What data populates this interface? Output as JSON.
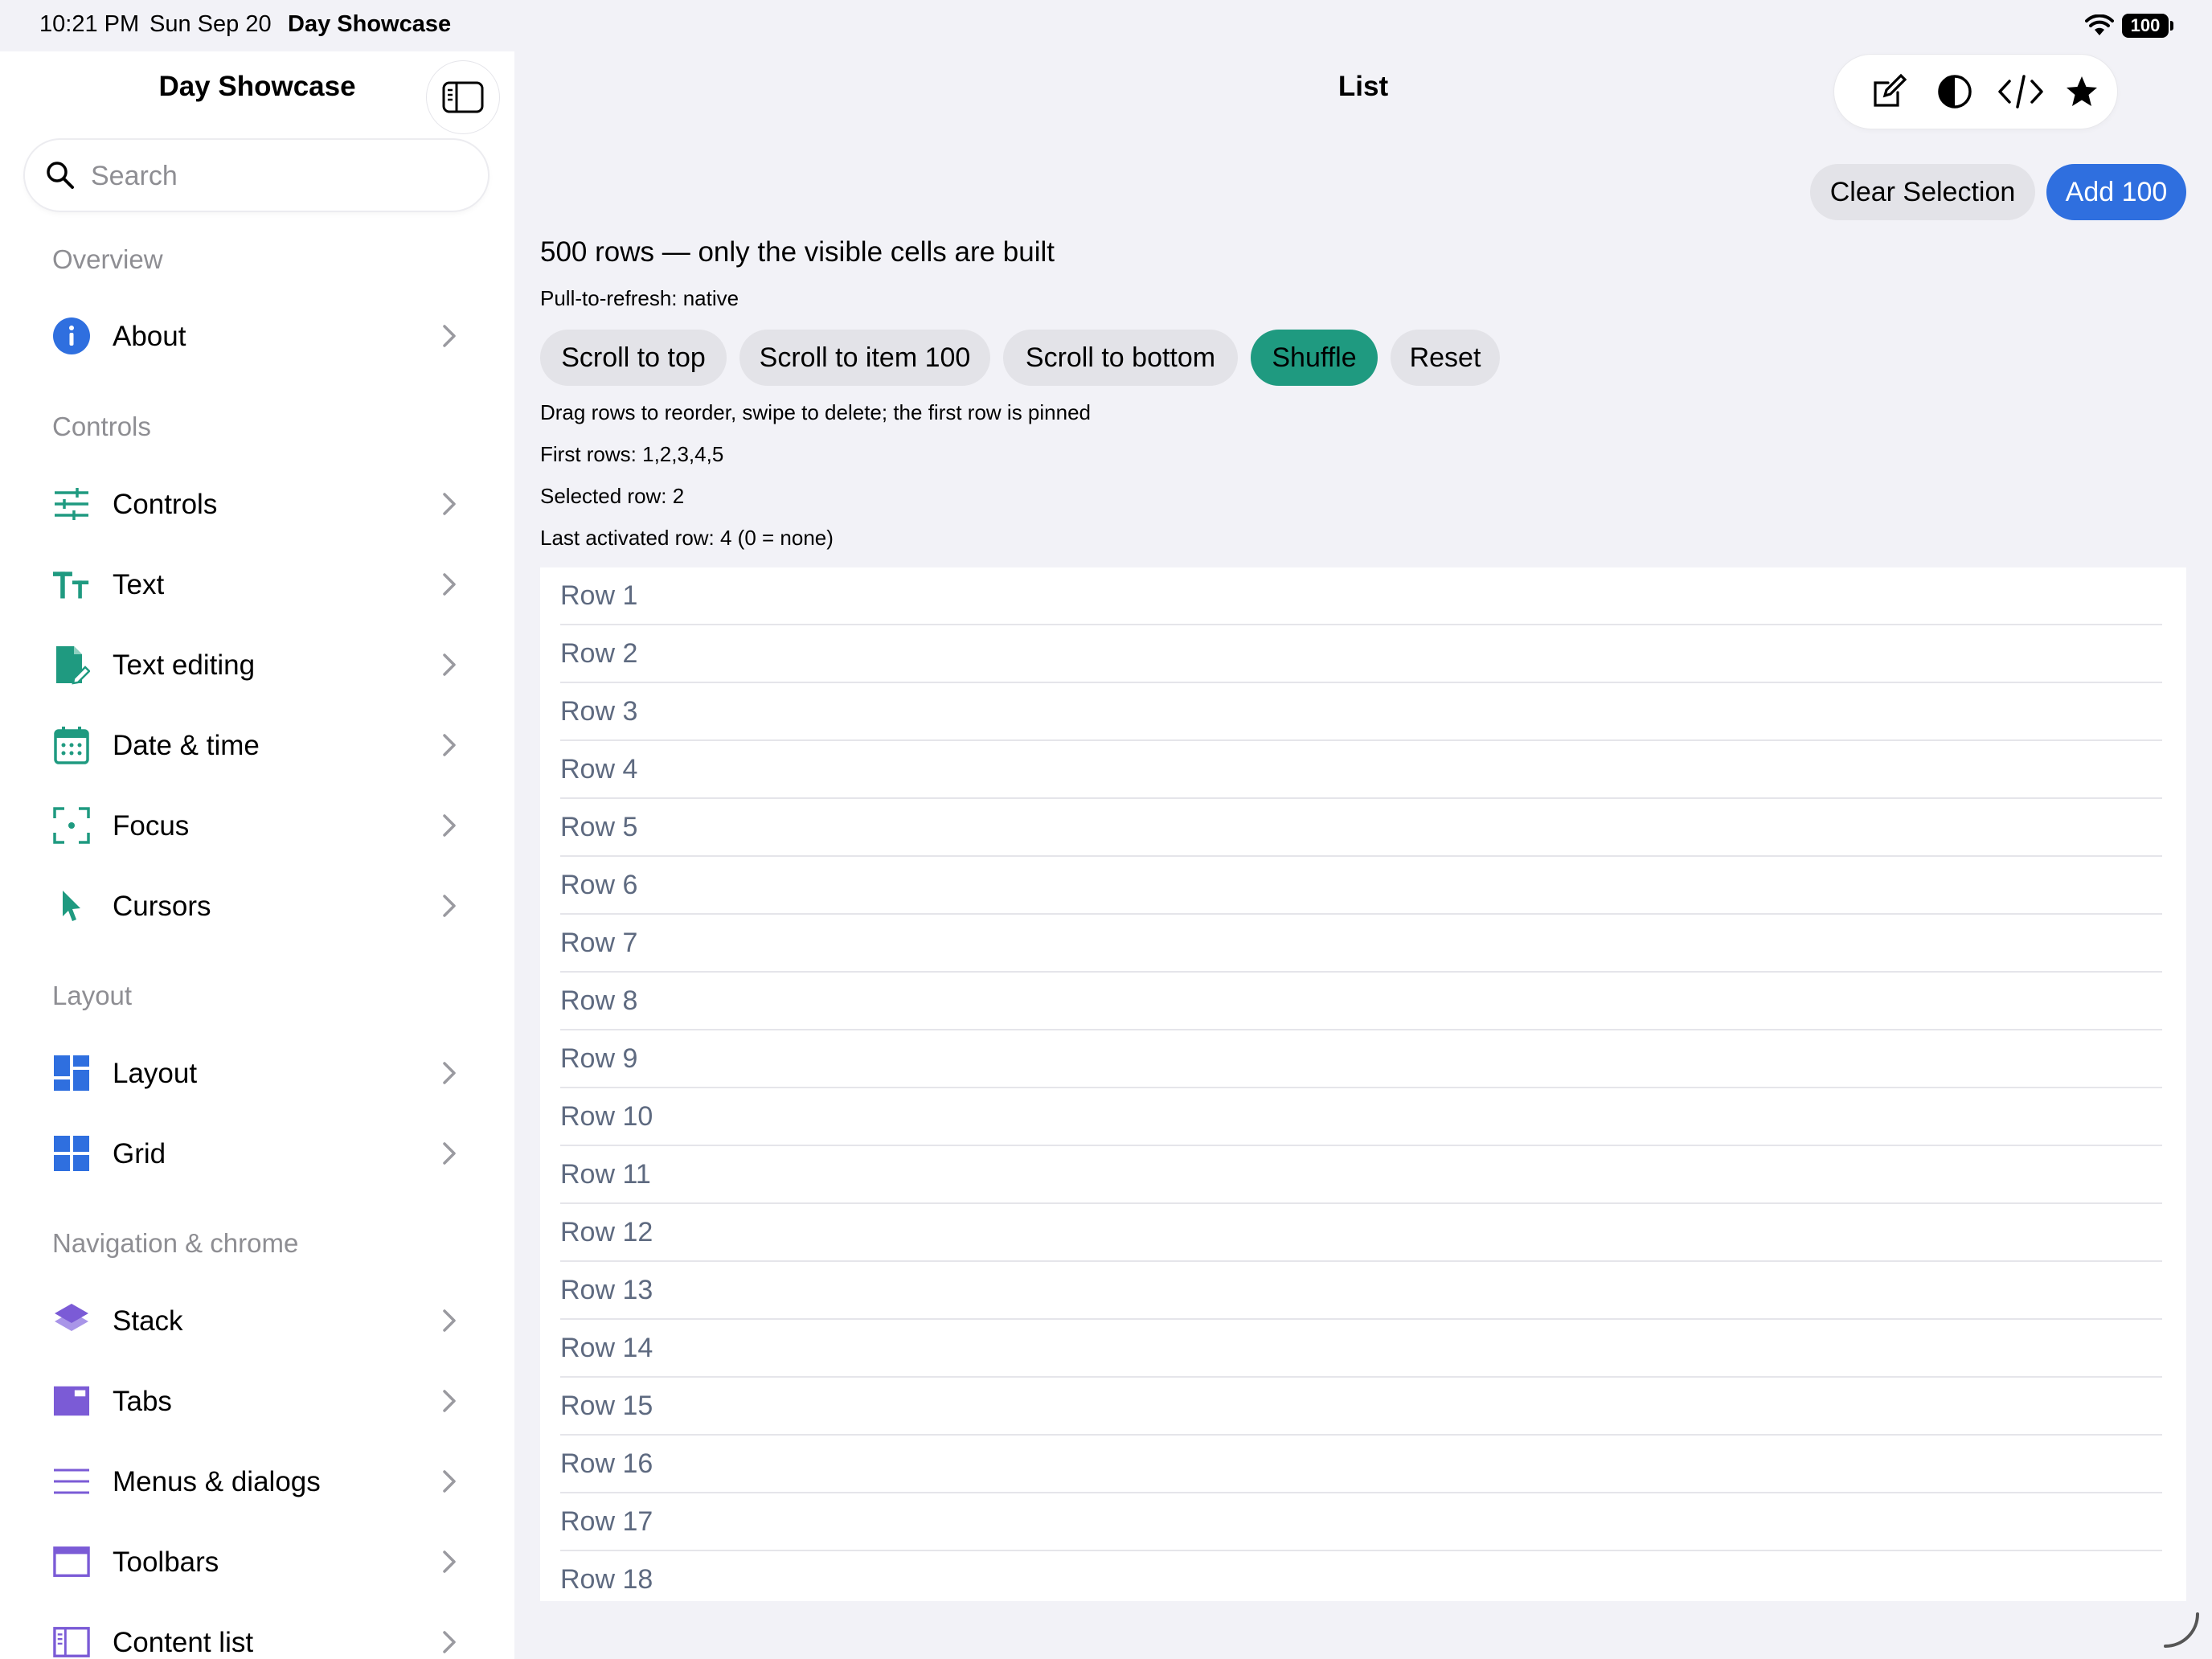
{
  "status_bar": {
    "time": "10:21 PM",
    "date": "Sun Sep 20",
    "app_name": "Day Showcase",
    "battery": "100"
  },
  "sidebar": {
    "title": "Day Showcase",
    "search_placeholder": "Search",
    "sections": [
      {
        "header": "Overview",
        "items": [
          {
            "label": "About",
            "icon": "info-icon",
            "color": "#2f6fdf"
          }
        ]
      },
      {
        "header": "Controls",
        "items": [
          {
            "label": "Controls",
            "icon": "sliders-icon",
            "color": "#1f9a80"
          },
          {
            "label": "Text",
            "icon": "text-size-icon",
            "color": "#1f9a80"
          },
          {
            "label": "Text editing",
            "icon": "doc-edit-icon",
            "color": "#1f9a80"
          },
          {
            "label": "Date & time",
            "icon": "calendar-icon",
            "color": "#1f9a80"
          },
          {
            "label": "Focus",
            "icon": "focus-icon",
            "color": "#1f9a80"
          },
          {
            "label": "Cursors",
            "icon": "cursor-icon",
            "color": "#1f9a80"
          }
        ]
      },
      {
        "header": "Layout",
        "items": [
          {
            "label": "Layout",
            "icon": "layout-icon",
            "color": "#2f6fdf"
          },
          {
            "label": "Grid",
            "icon": "grid-icon",
            "color": "#2f6fdf"
          }
        ]
      },
      {
        "header": "Navigation & chrome",
        "items": [
          {
            "label": "Stack",
            "icon": "stack-icon",
            "color": "#7b5bd6"
          },
          {
            "label": "Tabs",
            "icon": "tabs-icon",
            "color": "#7b5bd6"
          },
          {
            "label": "Menus & dialogs",
            "icon": "menu-lines-icon",
            "color": "#7b5bd6"
          },
          {
            "label": "Toolbars",
            "icon": "toolbar-icon",
            "color": "#7b5bd6"
          },
          {
            "label": "Content list",
            "icon": "content-list-icon",
            "color": "#7b5bd6"
          }
        ]
      }
    ]
  },
  "main": {
    "title": "List",
    "toolbar_icons": [
      "compose-icon",
      "contrast-icon",
      "code-icon",
      "star-icon"
    ],
    "clear_selection_label": "Clear Selection",
    "add_label": "Add 100",
    "headline": "500 rows — only the visible cells are built",
    "refresh_text": "Pull-to-refresh: native",
    "scroll_buttons": [
      {
        "label": "Scroll to top",
        "style": "gray"
      },
      {
        "label": "Scroll to item 100",
        "style": "gray"
      },
      {
        "label": "Scroll to bottom",
        "style": "gray"
      },
      {
        "label": "Shuffle",
        "style": "green"
      },
      {
        "label": "Reset",
        "style": "gray"
      }
    ],
    "info_lines": [
      "Drag rows to reorder, swipe to delete; the first row is pinned",
      "First rows: 1,2,3,4,5",
      "Selected row: 2",
      "Last activated row: 4 (0 = none)"
    ],
    "rows": [
      "Row 1",
      "Row 2",
      "Row 3",
      "Row 4",
      "Row 5",
      "Row 6",
      "Row 7",
      "Row 8",
      "Row 9",
      "Row 10",
      "Row 11",
      "Row 12",
      "Row 13",
      "Row 14",
      "Row 15",
      "Row 16",
      "Row 17",
      "Row 18"
    ]
  },
  "colors": {
    "accent_blue": "#2f6fdf",
    "accent_green": "#1f9a80",
    "accent_purple": "#7b5bd6"
  }
}
